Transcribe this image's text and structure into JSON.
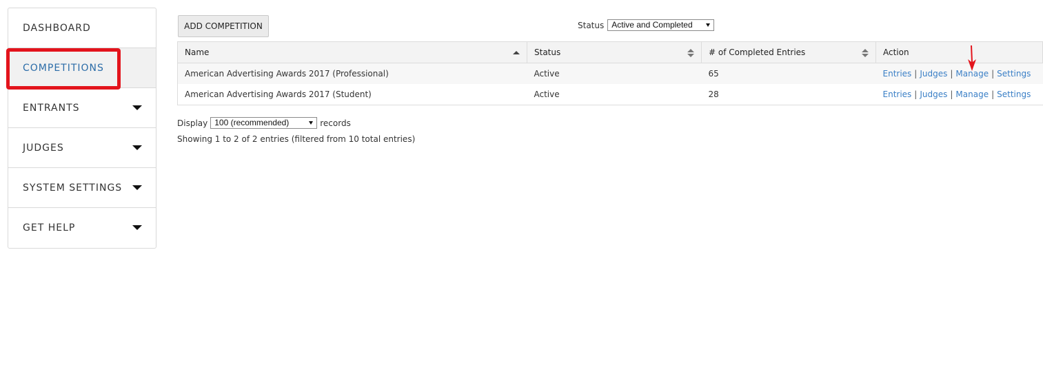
{
  "sidebar": {
    "items": [
      {
        "label": "DASHBOARD",
        "caret": false,
        "active": false
      },
      {
        "label": "COMPETITIONS",
        "caret": false,
        "active": true
      },
      {
        "label": "ENTRANTS",
        "caret": true,
        "active": false
      },
      {
        "label": "JUDGES",
        "caret": true,
        "active": false
      },
      {
        "label": "SYSTEM SETTINGS",
        "caret": true,
        "active": false
      },
      {
        "label": "GET HELP",
        "caret": true,
        "active": false
      }
    ]
  },
  "toolbar": {
    "add_label": "ADD COMPETITION",
    "status_label": "Status",
    "status_value": "Active and Completed"
  },
  "table": {
    "columns": [
      "Name",
      "Status",
      "# of Completed Entries",
      "Action"
    ],
    "rows": [
      {
        "name": "American Advertising Awards 2017 (Professional)",
        "status": "Active",
        "entries": "65",
        "actions": [
          "Entries",
          "Judges",
          "Manage",
          "Settings"
        ]
      },
      {
        "name": "American Advertising Awards 2017 (Student)",
        "status": "Active",
        "entries": "28",
        "actions": [
          "Entries",
          "Judges",
          "Manage",
          "Settings"
        ]
      }
    ]
  },
  "footer": {
    "display_label": "Display",
    "display_value": "100 (recommended)",
    "records_label": "records",
    "summary": "Showing 1 to 2 of 2 entries (filtered from 10 total entries)"
  },
  "colors": {
    "accent": "#2b6ca8",
    "link": "#3a7fc6",
    "highlight": "#e3141c"
  },
  "icons": [
    "caret-down-icon",
    "sort-asc-icon",
    "sort-both-icon",
    "red-arrow-icon"
  ]
}
